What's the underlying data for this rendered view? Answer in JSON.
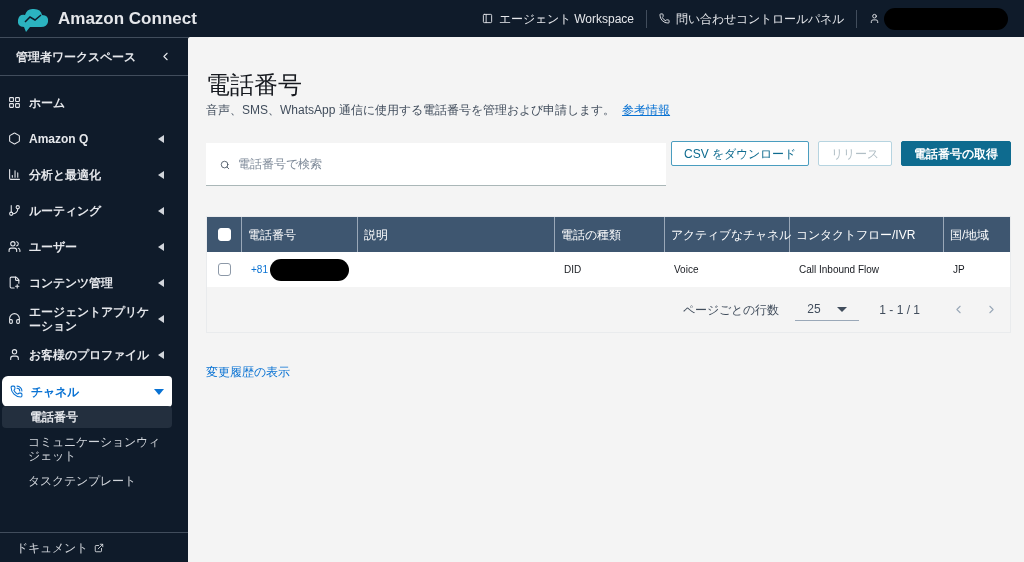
{
  "header": {
    "brand": "Amazon Connect",
    "links": [
      {
        "label": "エージェント Workspace"
      },
      {
        "label": "問い合わせコントロールパネル"
      }
    ]
  },
  "sidebar": {
    "title": "管理者ワークスペース",
    "items": [
      {
        "label": "ホーム",
        "kind": "link",
        "selected": false
      },
      {
        "label": "Amazon Q",
        "kind": "group",
        "expanded": false,
        "selected": false
      },
      {
        "label": "分析と最適化",
        "kind": "group",
        "expanded": false,
        "selected": false
      },
      {
        "label": "ルーティング",
        "kind": "group",
        "expanded": false,
        "selected": false
      },
      {
        "label": "ユーザー",
        "kind": "group",
        "expanded": false,
        "selected": false
      },
      {
        "label": "コンテンツ管理",
        "kind": "group",
        "expanded": false,
        "selected": false
      },
      {
        "label": "エージェントアプリケーション",
        "kind": "group",
        "expanded": false,
        "selected": false
      },
      {
        "label": "お客様のプロファイル",
        "kind": "group",
        "expanded": false,
        "selected": false
      },
      {
        "label": "チャネル",
        "kind": "group",
        "expanded": true,
        "selected": true,
        "children": [
          {
            "label": "電話番号",
            "selected": true
          },
          {
            "label": "コミュニケーションウィジェット",
            "selected": false
          },
          {
            "label": "タスクテンプレート",
            "selected": false
          }
        ]
      }
    ],
    "footer_link": "ドキュメント"
  },
  "page": {
    "title": "電話番号",
    "description": "音声、SMS、WhatsApp 通信に使用する電話番号を管理および申請します。",
    "info_link": "参考情報",
    "search": {
      "placeholder": "電話番号で検索"
    },
    "buttons": [
      {
        "label": "CSV をダウンロード",
        "kind": "secondary",
        "disabled": false
      },
      {
        "label": "リリース",
        "kind": "secondary",
        "disabled": true
      },
      {
        "label": "電話番号の取得",
        "kind": "primary",
        "disabled": false
      }
    ],
    "table": {
      "select_all_checked": false,
      "columns": [
        "電話番号",
        "説明",
        "電話の種類",
        "アクティブなチャネル",
        "コンタクトフロー/IVR",
        "国/地域"
      ],
      "rows": [
        {
          "checked": false,
          "cells": [
            "+81",
            "",
            "DID",
            "Voice",
            "Call Inbound Flow",
            "JP"
          ]
        }
      ]
    },
    "pagination": {
      "label": "ページごとの行数",
      "page_size": "25",
      "range": "1 - 1 / 1"
    },
    "history_link": "変更履歴の表示"
  }
}
